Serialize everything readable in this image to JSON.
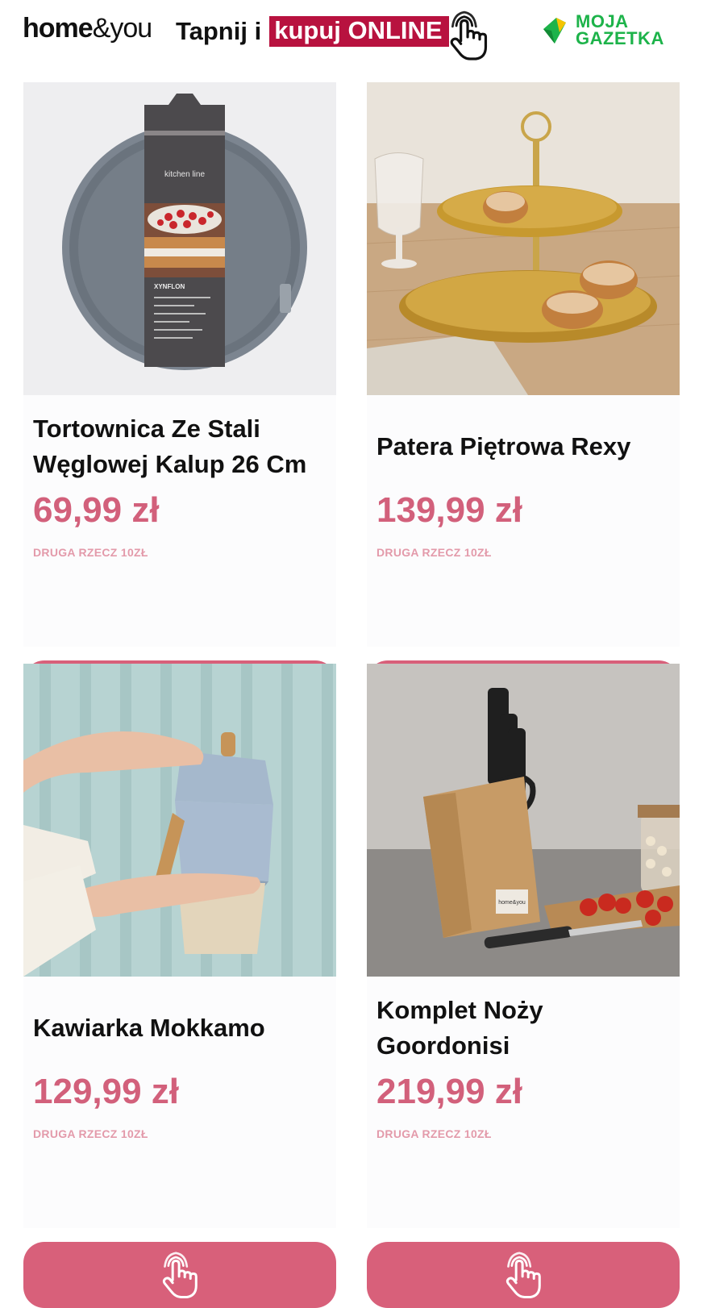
{
  "header": {
    "brand_bold": "home",
    "brand_light": "&you",
    "tagline_prefix": "Tapnij i",
    "tagline_highlight": "kupuj ONLINE",
    "partner_line1": "MOJA",
    "partner_line2": "GAZETKA",
    "tap_icon": "tap-hand-icon",
    "colors": {
      "highlight": "#b8123f",
      "partner": "#1db34a"
    }
  },
  "colors": {
    "price": "#d2607b",
    "button": "#d8607a",
    "note": "#e39aaa"
  },
  "products": [
    {
      "title": "Tortownica Ze Stali Węglowej Kalup 26 Cm",
      "price": "69,99 zł",
      "note": "DRUGA RZECZ 10ZŁ",
      "button_icon": "tap-hand-icon"
    },
    {
      "title": "Patera Piętrowa Rexy",
      "price": "139,99 zł",
      "note": "DRUGA RZECZ 10ZŁ",
      "button_icon": "tap-hand-icon"
    },
    {
      "title": "Kawiarka Mokkamo",
      "price": "129,99 zł",
      "note": "DRUGA RZECZ 10ZŁ",
      "button_icon": "tap-hand-icon"
    },
    {
      "title": "Komplet Noży Goordonisi",
      "price": "219,99 zł",
      "note": "DRUGA RZECZ 10ZŁ",
      "button_icon": "tap-hand-icon"
    }
  ],
  "images": {
    "p0_label_brand": "kitchen line",
    "p0_label_material": "XYNFLON",
    "p3_block_brand": "home&you"
  }
}
